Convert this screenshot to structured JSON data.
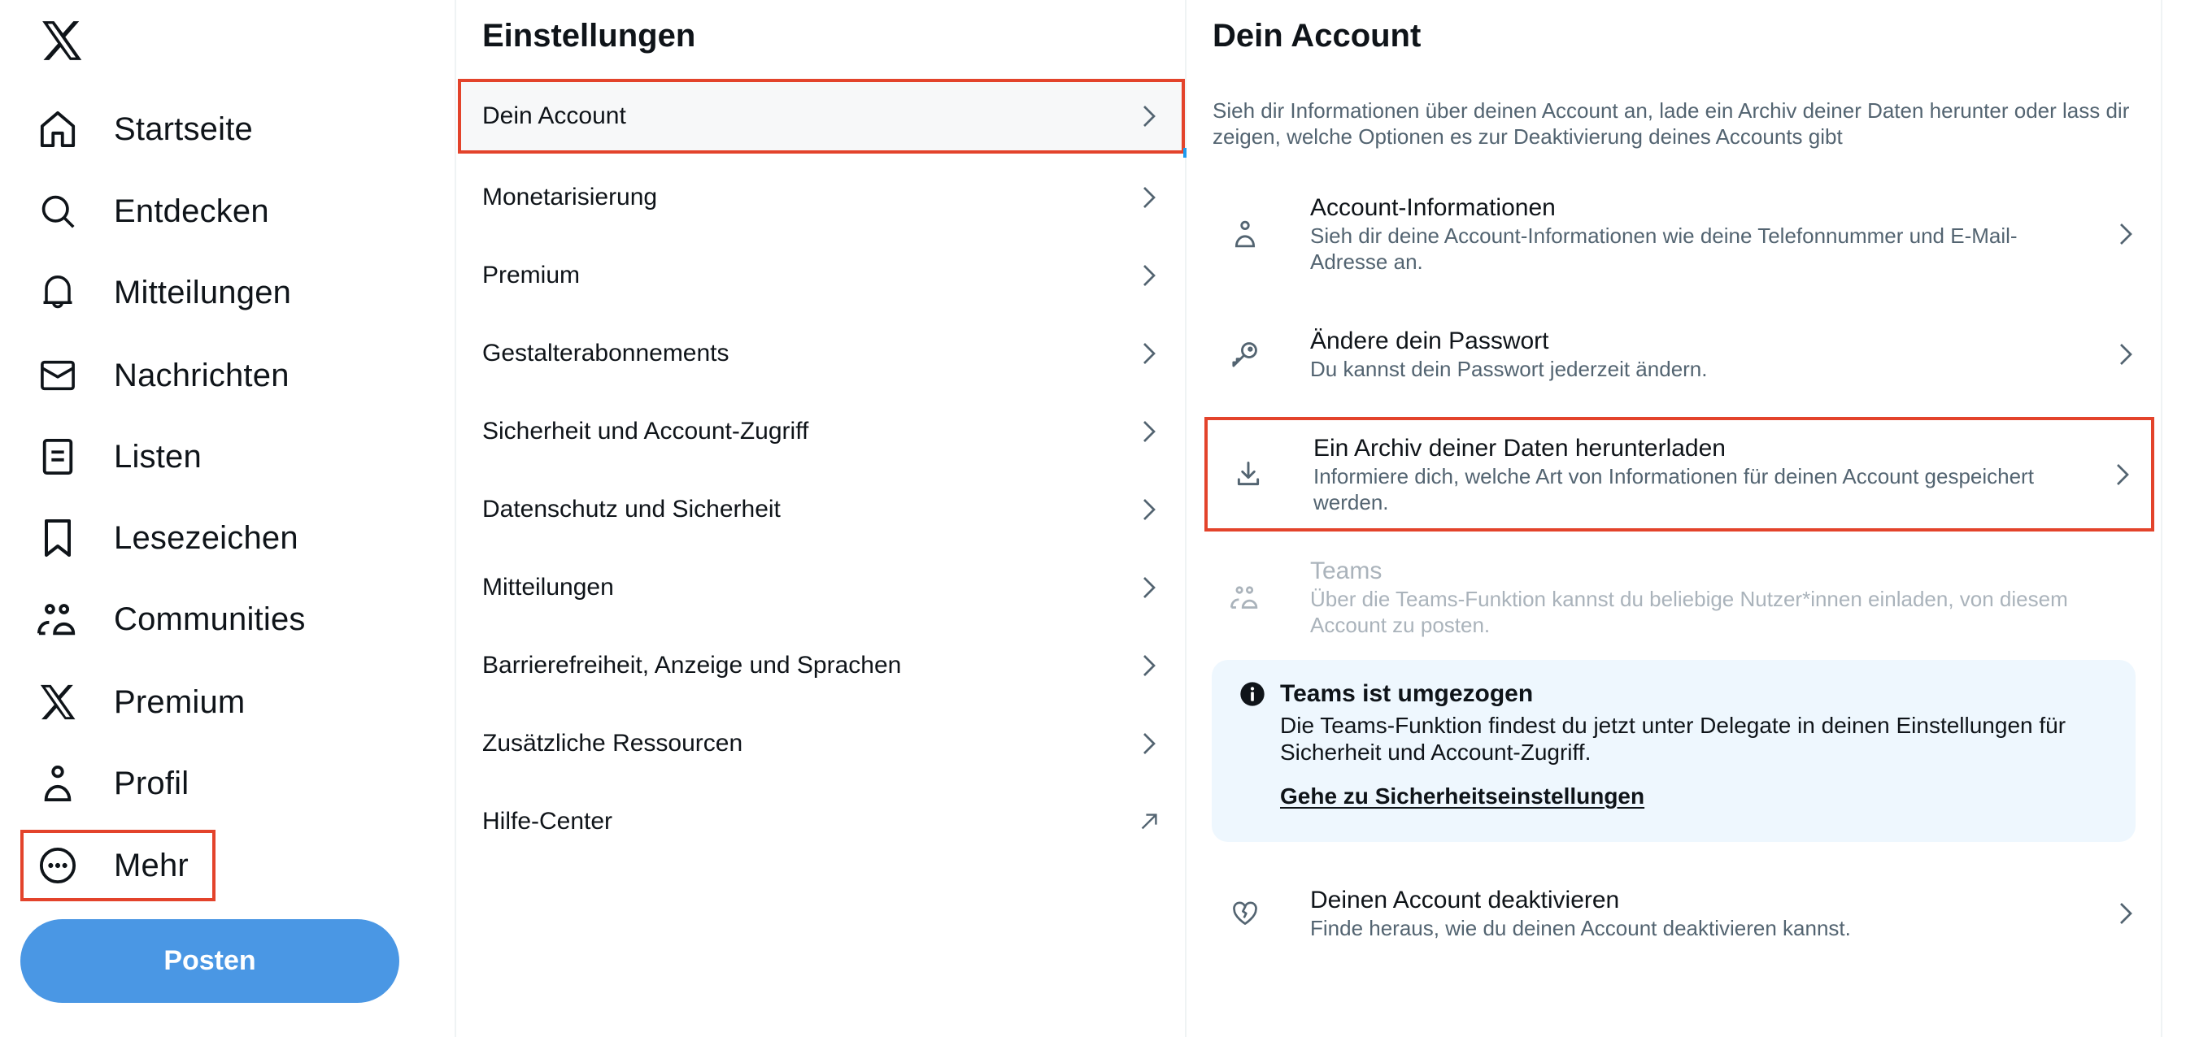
{
  "app": {
    "brand": "X",
    "colors": {
      "accent": "#4a97e4",
      "highlight_border": "#e3432b",
      "text_primary": "#0f1419",
      "text_secondary": "#536471",
      "info_bg": "#eef7fe"
    }
  },
  "sidebar": {
    "logo_icon": "x-logo-icon",
    "items": [
      {
        "label": "Startseite",
        "icon": "home-icon"
      },
      {
        "label": "Entdecken",
        "icon": "search-icon"
      },
      {
        "label": "Mitteilungen",
        "icon": "bell-icon"
      },
      {
        "label": "Nachrichten",
        "icon": "mail-icon"
      },
      {
        "label": "Listen",
        "icon": "list-icon"
      },
      {
        "label": "Lesezeichen",
        "icon": "bookmark-icon"
      },
      {
        "label": "Communities",
        "icon": "communities-icon"
      },
      {
        "label": "Premium",
        "icon": "x-logo-icon"
      },
      {
        "label": "Profil",
        "icon": "person-icon"
      },
      {
        "label": "Mehr",
        "icon": "more-circle-icon"
      }
    ],
    "post_button": "Posten"
  },
  "settings": {
    "title": "Einstellungen",
    "items": [
      {
        "label": "Dein Account",
        "icon": "chevron-right-icon",
        "selected": true
      },
      {
        "label": "Monetarisierung",
        "icon": "chevron-right-icon"
      },
      {
        "label": "Premium",
        "icon": "chevron-right-icon"
      },
      {
        "label": "Gestalterabonnements",
        "icon": "chevron-right-icon"
      },
      {
        "label": "Sicherheit und Account-Zugriff",
        "icon": "chevron-right-icon"
      },
      {
        "label": "Datenschutz und Sicherheit",
        "icon": "chevron-right-icon"
      },
      {
        "label": "Mitteilungen",
        "icon": "chevron-right-icon"
      },
      {
        "label": "Barrierefreiheit, Anzeige und Sprachen",
        "icon": "chevron-right-icon"
      },
      {
        "label": "Zusätzliche Ressourcen",
        "icon": "chevron-right-icon"
      },
      {
        "label": "Hilfe-Center",
        "icon": "external-link-arrow-icon"
      }
    ]
  },
  "account": {
    "title": "Dein Account",
    "description": "Sieh dir Informationen über deinen Account an, lade ein Archiv deiner Daten herunter oder lass dir zeigen, welche Optionen es zur Deaktivierung deines Accounts gibt",
    "items": [
      {
        "title": "Account-Informationen",
        "desc": "Sieh dir deine Account-Informationen wie deine Telefonnummer und E-Mail-Adresse an.",
        "icon": "person-icon"
      },
      {
        "title": "Ändere dein Passwort",
        "desc": "Du kannst dein Passwort jederzeit ändern.",
        "icon": "key-icon"
      },
      {
        "title": "Ein Archiv deiner Daten herunterladen",
        "desc": "Informiere dich, welche Art von Informationen für deinen Account gespeichert werden.",
        "icon": "download-icon"
      },
      {
        "title": "Teams",
        "desc": "Über die Teams-Funktion kannst du beliebige Nutzer*innen einladen, von diesem Account zu posten.",
        "icon": "communities-icon",
        "disabled": true
      },
      {
        "title": "Deinen Account deaktivieren",
        "desc": "Finde heraus, wie du deinen Account deaktivieren kannst.",
        "icon": "broken-heart-icon"
      }
    ],
    "info_box": {
      "icon": "info-icon",
      "title": "Teams ist umgezogen",
      "body": "Die Teams-Funktion findest du jetzt unter Delegate in deinen Einstellungen für Sicherheit und Account-Zugriff.",
      "link": "Gehe zu Sicherheitseinstellungen"
    }
  }
}
